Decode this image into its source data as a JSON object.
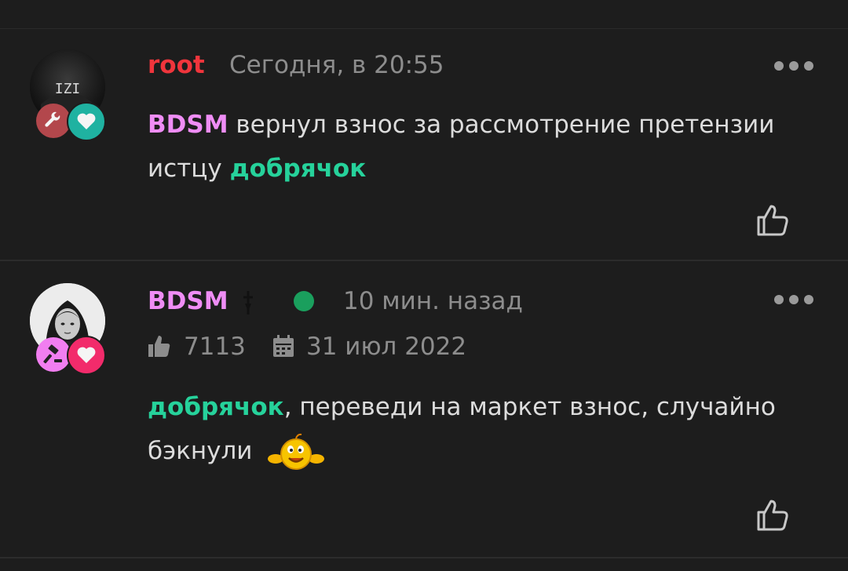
{
  "colors": {
    "background": "#1d1d1d",
    "root_name": "#f0353c",
    "bdsm_name": "#ef8df5",
    "dobryachok": "#26d29b",
    "meta": "#8d8d8d",
    "body": "#dcdcdc",
    "online": "#1a9f5d",
    "badge_red": "#b3474c",
    "badge_teal": "#1fb2a1",
    "badge_pink": "#f17ef0",
    "badge_heart": "#f22b6b"
  },
  "comments": [
    {
      "author": "root",
      "timestamp": "Сегодня, в 20:55",
      "badges": [
        "wrench-icon",
        "heart-icon"
      ],
      "body": {
        "mention": "BDSM",
        "text": " вернул взнос за рассмотрение претензии истцу ",
        "mention2": "добрячок"
      }
    },
    {
      "author": "BDSM",
      "author_suffix_icon": "dagger-icon",
      "online": true,
      "timestamp": "10 мин. назад",
      "likes_count": "7113",
      "registration_date": "31 июл 2022",
      "badges": [
        "gavel-icon",
        "heart-icon"
      ],
      "body": {
        "mention": "добрячок",
        "text": ", переведи на маркет взнос, случайно бэкнули",
        "emoji": "smiley-emoji"
      }
    }
  ]
}
